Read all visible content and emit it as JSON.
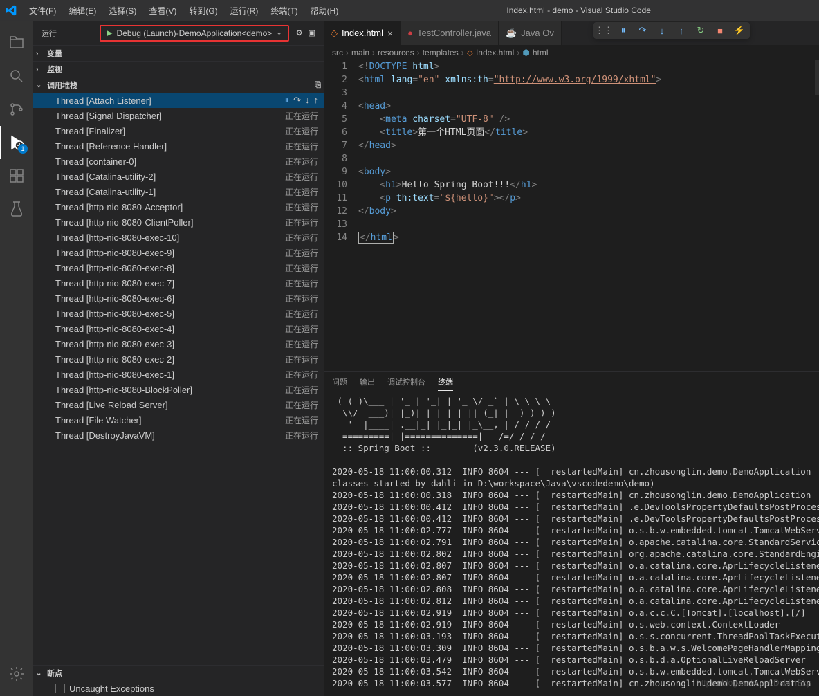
{
  "window_title": "Index.html - demo - Visual Studio Code",
  "menu": [
    "文件(F)",
    "编辑(E)",
    "选择(S)",
    "查看(V)",
    "转到(G)",
    "运行(R)",
    "终端(T)",
    "帮助(H)"
  ],
  "activity_badge": "1",
  "sidebar_title": "运行",
  "run_config": "Debug (Launch)-DemoApplication<demo>",
  "sections": {
    "variables": "变量",
    "watch": "监视",
    "callstack": "调用堆栈",
    "breakpoints": "断点"
  },
  "status_running": "正在运行",
  "threads": [
    "Thread [Attach Listener]",
    "Thread [Signal Dispatcher]",
    "Thread [Finalizer]",
    "Thread [Reference Handler]",
    "Thread [container-0]",
    "Thread [Catalina-utility-2]",
    "Thread [Catalina-utility-1]",
    "Thread [http-nio-8080-Acceptor]",
    "Thread [http-nio-8080-ClientPoller]",
    "Thread [http-nio-8080-exec-10]",
    "Thread [http-nio-8080-exec-9]",
    "Thread [http-nio-8080-exec-8]",
    "Thread [http-nio-8080-exec-7]",
    "Thread [http-nio-8080-exec-6]",
    "Thread [http-nio-8080-exec-5]",
    "Thread [http-nio-8080-exec-4]",
    "Thread [http-nio-8080-exec-3]",
    "Thread [http-nio-8080-exec-2]",
    "Thread [http-nio-8080-exec-1]",
    "Thread [http-nio-8080-BlockPoller]",
    "Thread [Live Reload Server]",
    "Thread [File Watcher]",
    "Thread [DestroyJavaVM]"
  ],
  "breakpoint_item": "Uncaught Exceptions",
  "tabs": [
    {
      "label": "Index.html",
      "icon": "html-icon",
      "active": true
    },
    {
      "label": "TestController.java",
      "icon": "java-icon",
      "active": false
    },
    {
      "label": "Java Ov",
      "icon": "java-cup-icon",
      "active": false
    }
  ],
  "breadcrumb": [
    "src",
    "main",
    "resources",
    "templates",
    "Index.html",
    "html"
  ],
  "code_lines": 14,
  "code": {
    "l1": {
      "p1": "<!",
      "p2": "DOCTYPE",
      "p3": " html",
      "p4": ">"
    },
    "l2": {
      "p1": "<",
      "p2": "html",
      "p3": " lang",
      "p4": "=",
      "p5": "\"en\"",
      "p6": " xmlns:th",
      "p7": "=",
      "p8": "\"http://www.w3.org/1999/xhtml\"",
      "p9": ">"
    },
    "l3": "",
    "l4": {
      "p1": "<",
      "p2": "head",
      "p3": ">"
    },
    "l5": {
      "p1": "    <",
      "p2": "meta",
      "p3": " charset",
      "p4": "=",
      "p5": "\"UTF-8\"",
      "p6": " />"
    },
    "l6": {
      "p1": "    <",
      "p2": "title",
      "p3": ">",
      "p4": "第一个HTML页面",
      "p5": "</",
      "p6": "title",
      "p7": ">"
    },
    "l7": {
      "p1": "</",
      "p2": "head",
      "p3": ">"
    },
    "l8": "",
    "l9": {
      "p1": "<",
      "p2": "body",
      "p3": ">"
    },
    "l10": {
      "p1": "    <",
      "p2": "h1",
      "p3": ">",
      "p4": "Hello Spring Boot!!!",
      "p5": "</",
      "p6": "h1",
      "p7": ">"
    },
    "l11": {
      "p1": "    <",
      "p2": "p",
      "p3": " th:text",
      "p4": "=",
      "p5": "\"${hello}\"",
      "p6": "></",
      "p7": "p",
      "p8": ">"
    },
    "l12": {
      "p1": "</",
      "p2": "body",
      "p3": ">"
    },
    "l13": "",
    "l14": {
      "p1": "</",
      "p2": "html",
      "p3": ">"
    }
  },
  "panel_tabs": [
    "问题",
    "输出",
    "调试控制台",
    "终端"
  ],
  "panel_active": 3,
  "terminal_art": " ( ( )\\___ | '_ | '_| | '_ \\/ _` | \\ \\ \\ \\\n  \\\\/  ___)| |_)| | | | | || (_| |  ) ) ) )\n   '  |____| .__|_| |_|_| |_\\__, | / / / /\n  =========|_|==============|___/=/_/_/_/\n  :: Spring Boot ::        (v2.3.0.RELEASE)\n",
  "terminal_log": "2020-05-18 11:00:00.312  INFO 8604 --- [  restartedMain] cn.zhousonglin.demo.DemoApplication      :\nclasses started by dahli in D:\\workspace\\Java\\vscodedemo\\demo)\n2020-05-18 11:00:00.318  INFO 8604 --- [  restartedMain] cn.zhousonglin.demo.DemoApplication      :\n2020-05-18 11:00:00.412  INFO 8604 --- [  restartedMain] .e.DevToolsPropertyDefaultsPostProcessor :\n2020-05-18 11:00:00.412  INFO 8604 --- [  restartedMain] .e.DevToolsPropertyDefaultsPostProcessor :\n2020-05-18 11:00:02.777  INFO 8604 --- [  restartedMain] o.s.b.w.embedded.tomcat.TomcatWebServer  :\n2020-05-18 11:00:02.791  INFO 8604 --- [  restartedMain] o.apache.catalina.core.StandardService   :\n2020-05-18 11:00:02.802  INFO 8604 --- [  restartedMain] org.apache.catalina.core.StandardEngine  :\n2020-05-18 11:00:02.807  INFO 8604 --- [  restartedMain] o.a.catalina.core.AprLifecycleListener   :\n2020-05-18 11:00:02.807  INFO 8604 --- [  restartedMain] o.a.catalina.core.AprLifecycleListener   :\n2020-05-18 11:00:02.808  INFO 8604 --- [  restartedMain] o.a.catalina.core.AprLifecycleListener   :\n2020-05-18 11:00:02.812  INFO 8604 --- [  restartedMain] o.a.catalina.core.AprLifecycleListener   :\n2020-05-18 11:00:02.919  INFO 8604 --- [  restartedMain] o.a.c.c.C.[Tomcat].[localhost].[/]       :\n2020-05-18 11:00:02.919  INFO 8604 --- [  restartedMain] o.s.web.context.ContextLoader            :\n2020-05-18 11:00:03.193  INFO 8604 --- [  restartedMain] o.s.s.concurrent.ThreadPoolTaskExecutor  :\n2020-05-18 11:00:03.309  INFO 8604 --- [  restartedMain] o.s.b.a.w.s.WelcomePageHandlerMapping    :\n2020-05-18 11:00:03.479  INFO 8604 --- [  restartedMain] o.s.b.d.a.OptionalLiveReloadServer       :\n2020-05-18 11:00:03.542  INFO 8604 --- [  restartedMain] o.s.b.w.embedded.tomcat.TomcatWebServer  :\n2020-05-18 11:00:03.577  INFO 8604 --- [  restartedMain] cn.zhousonglin.demo.DemoApplication      :",
  "watermark": "https://blog.csdn.net/DahlinSky"
}
